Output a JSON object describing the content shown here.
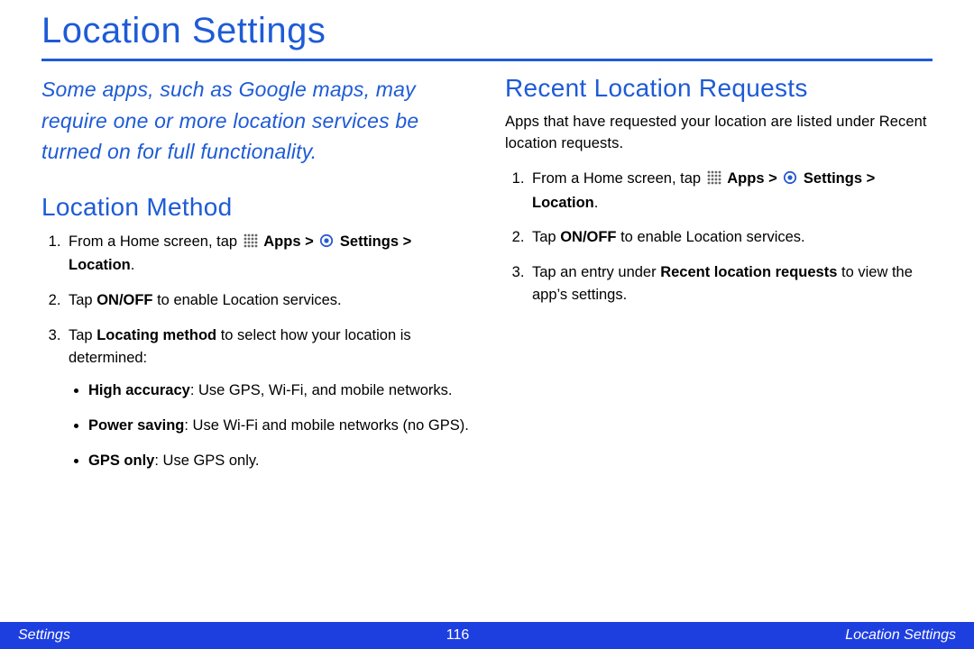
{
  "title": "Location Settings",
  "intro": "Some apps, such as Google maps, may require one or more location services be turned on for full functionality.",
  "left": {
    "heading": "Location Method",
    "step1_a": "From a Home screen, tap ",
    "step1_apps": "Apps",
    "step1_gt1": " > ",
    "step1_settings": "Settings",
    "step1_gt2": " > ",
    "step1_location": "Location",
    "step1_dot": ".",
    "step2_a": "Tap ",
    "step2_onoff": "ON/OFF",
    "step2_b": " to enable Location services.",
    "step3_a": "Tap ",
    "step3_locmethod": "Locating method",
    "step3_b": " to select how your location is determined:",
    "bullets": {
      "b1_label": "High accuracy",
      "b1_rest": ": Use GPS, Wi-Fi, and mobile networks.",
      "b2_label": "Power saving",
      "b2_rest": ": Use Wi-Fi and mobile networks (no GPS).",
      "b3_label": "GPS only",
      "b3_rest": ": Use GPS only."
    }
  },
  "right": {
    "heading": "Recent Location Requests",
    "lead": "Apps that have requested your location are listed under Recent location requests.",
    "step1_a": "From a Home screen, tap ",
    "step1_apps": "Apps",
    "step1_gt1": " > ",
    "step1_settings": "Settings",
    "step1_gt2": " > ",
    "step1_location": "Location",
    "step1_dot": ".",
    "step2_a": "Tap ",
    "step2_onoff": "ON/OFF",
    "step2_b": " to enable Location services.",
    "step3_a": "Tap an entry under ",
    "step3_recent": "Recent location requests",
    "step3_b": " to view the app’s settings."
  },
  "footer": {
    "left": "Settings",
    "center": "116",
    "right": "Location Settings"
  },
  "icons": {
    "apps": "apps-grid-icon",
    "settings": "settings-target-icon"
  }
}
